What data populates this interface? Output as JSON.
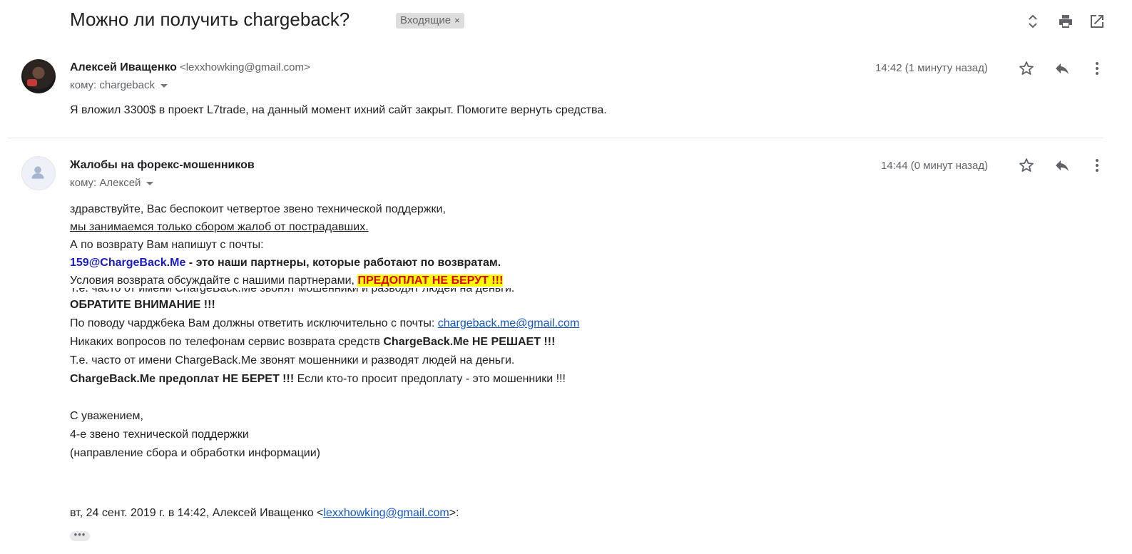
{
  "thread": {
    "subject": "Можно ли получить chargeback?",
    "label": "Входящие"
  },
  "messages": [
    {
      "sender_name": "Алексей Иващенко",
      "sender_email": "<lexxhowking@gmail.com>",
      "to": "кому: chargeback",
      "time": "14:42 (1 минуту назад)",
      "body": "Я вложил 3300$ в проект L7trade, на данный момент ихний сайт закрыт. Помогите вернуть средства."
    },
    {
      "sender_name": "Жалобы на форекс-мошенников",
      "to": "кому: Алексей",
      "time": "14:44 (0 минут назад)",
      "body": {
        "line1": "здравствуйте, Вас беспокоит четвертое звено технической поддержки,",
        "line2": "мы занимаемся только сбором жалоб от пострадавших.",
        "line3": "А по возврату Вам напишут с почты:",
        "line4_email": "159@ChargeBack.Me",
        "line4_rest": " - это наши партнеры, которые работают по возвратам.",
        "line5_text": "Условия возврата обсуждайте с нашими партнерами, ",
        "line5_highlight": "ПРЕДОПЛАТ НЕ БЕРУТ !!!",
        "line6": "ОБРАТИТЕ ВНИМАНИЕ !!!",
        "line7_text": "По поводу чарджбека Вам должны ответить исключительно с почты: ",
        "line7_link": "chargeback.me@gmail.com",
        "line8_text": "Никаких вопросов по телефонам сервис возврата средств ",
        "line8_bold": "ChargeBack.Me НЕ РЕШАЕТ !!!",
        "line9": "Т.е. часто от имени ChargeBack.Me звонят мошенники и разводят людей на деньги.",
        "line10_bold": "ChargeBack.Me предоплат НЕ БЕРЕТ !!!",
        "line10_rest": " Если кто-то просит предоплату - это мошенники !!!",
        "sig1": "С уважением,",
        "sig2": "4-е звено технической поддержки",
        "sig3": "(направление сбора и обработки информации)",
        "quote_prefix": "вт, 24 сент. 2019 г. в 14:42, Алексей Иващенко <",
        "quote_link": "lexxhowking@gmail.com",
        "quote_suffix": ">:",
        "show_trimmed": "•••"
      }
    }
  ],
  "icons": {
    "expand": "unfold-icon",
    "print": "print-icon",
    "new_window": "open-in-new-icon",
    "star": "star-icon",
    "reply": "reply-icon",
    "more": "more-vert-icon"
  },
  "colors": {
    "link": "#1155cc",
    "highlight_bg": "#ffff00",
    "highlight_text": "#e00000",
    "partner_email": "#1a1ac8"
  }
}
